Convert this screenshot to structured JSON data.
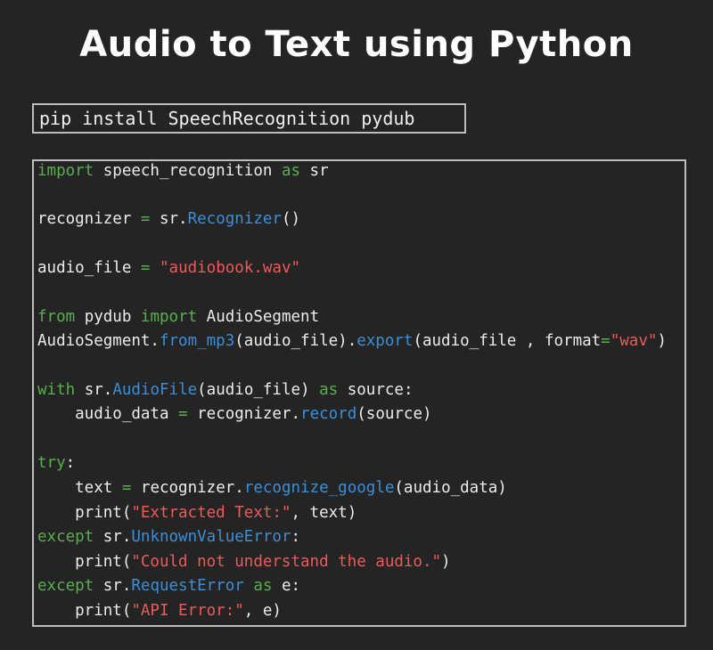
{
  "title": "Audio to Text using Python",
  "install_command": "pip install SpeechRecognition pydub",
  "code": {
    "l1": {
      "kw1": "import",
      "t1": " speech_recognition ",
      "kw2": "as",
      "t2": " sr"
    },
    "l2": {
      "t1": "recognizer ",
      "op1": "=",
      "t2": " sr.",
      "fn1": "Recognizer",
      "t3": "()"
    },
    "l3": {
      "t1": "audio_file ",
      "op1": "=",
      "t2": " ",
      "str1": "\"audiobook.wav\""
    },
    "l4": {
      "kw1": "from",
      "t1": " pydub ",
      "kw2": "import",
      "t2": " AudioSegment"
    },
    "l5": {
      "t1": "AudioSegment.",
      "fn1": "from_mp3",
      "t2": "(audio_file).",
      "fn2": "export",
      "t3": "(audio_file , format",
      "op1": "=",
      "str1": "\"wav\"",
      "t4": ")"
    },
    "l6": {
      "kw1": "with",
      "t1": " sr.",
      "fn1": "AudioFile",
      "t2": "(audio_file) ",
      "kw2": "as",
      "t3": " source:"
    },
    "l7": {
      "t1": "    audio_data ",
      "op1": "=",
      "t2": " recognizer.",
      "fn1": "record",
      "t3": "(source)"
    },
    "l8": {
      "kw1": "try",
      "t1": ":"
    },
    "l9": {
      "t1": "    text ",
      "op1": "=",
      "t2": " recognizer.",
      "fn1": "recognize_google",
      "t3": "(audio_data)"
    },
    "l10": {
      "t1": "    print(",
      "str1": "\"Extracted Text:\"",
      "t2": ", text)"
    },
    "l11": {
      "kw1": "except",
      "t1": " sr.",
      "fn1": "UnknownValueError",
      "t2": ":"
    },
    "l12": {
      "t1": "    print(",
      "str1": "\"Could not understand the audio.\"",
      "t2": ")"
    },
    "l13": {
      "kw1": "except",
      "t1": " sr.",
      "fn1": "RequestError",
      "t2": " ",
      "kw2": "as",
      "t3": " e:"
    },
    "l14": {
      "t1": "    print(",
      "str1": "\"API Error:\"",
      "t2": ", e)"
    }
  },
  "colors": {
    "background": "#242424",
    "keyword": "#56b04b",
    "function": "#3a8fd8",
    "string": "#ec5a5a",
    "text": "#ececec",
    "border": "#bdbdbd"
  }
}
